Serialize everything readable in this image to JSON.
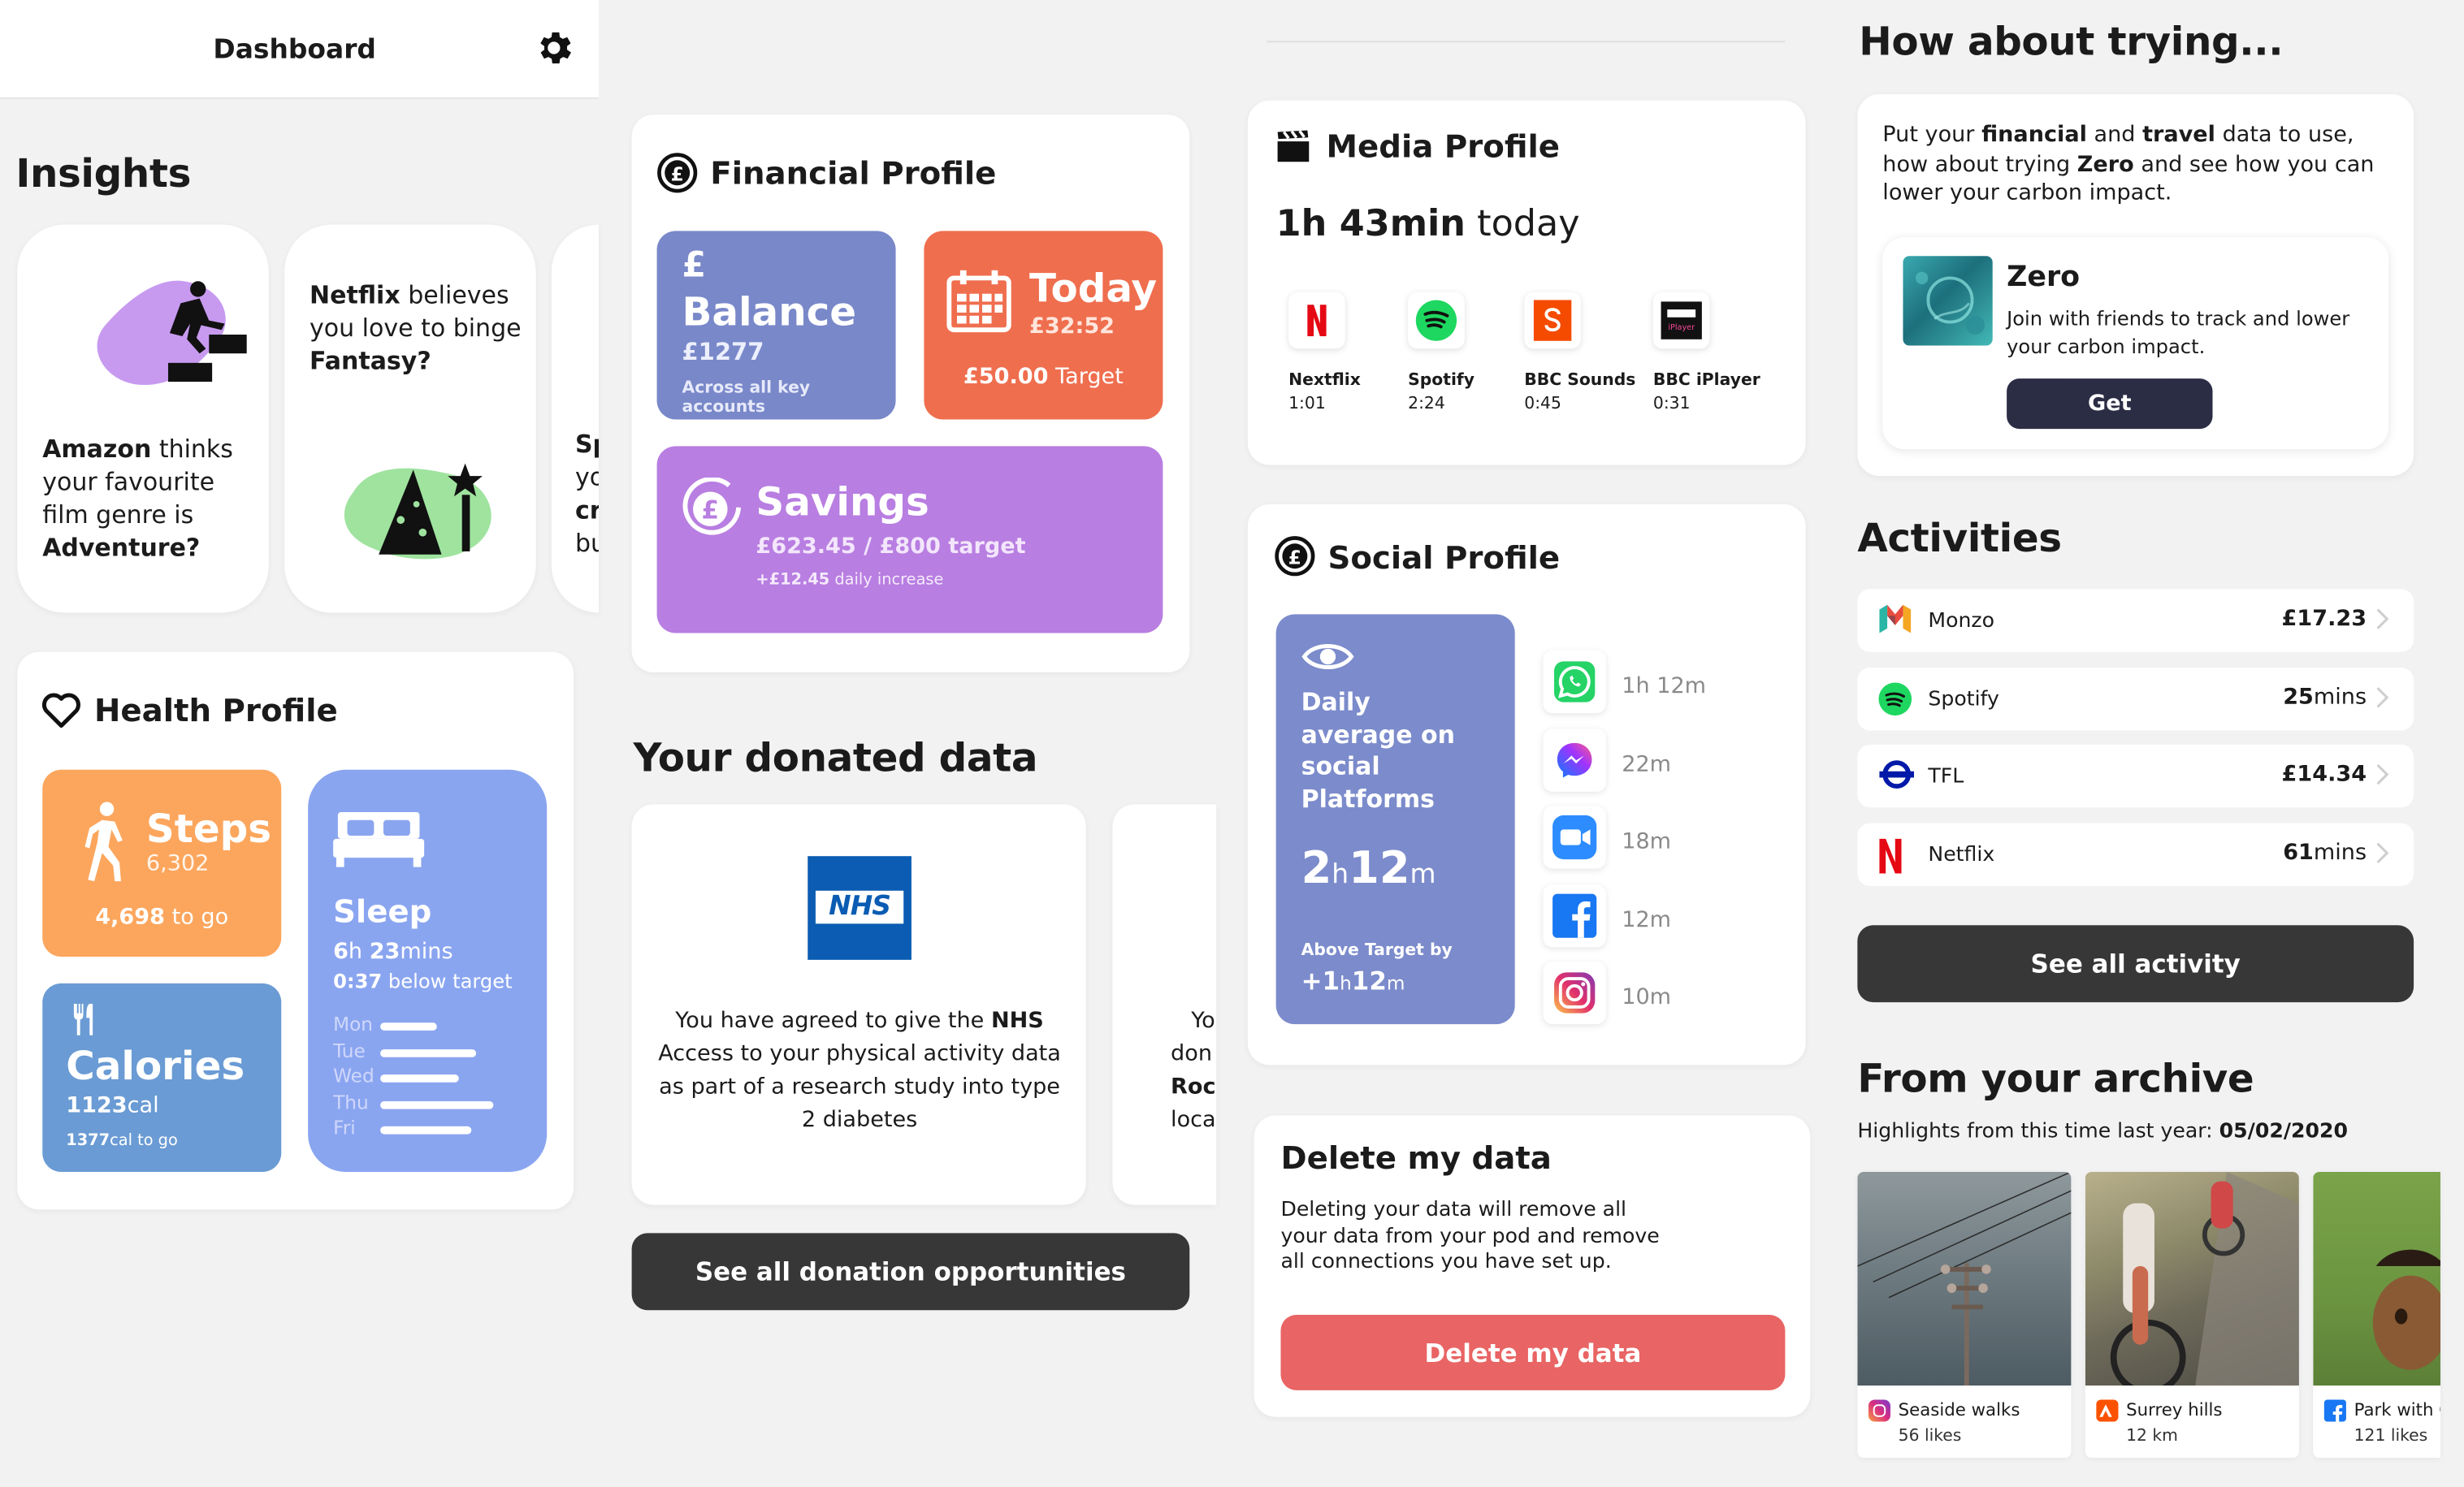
{
  "header": {
    "title": "Dashboard",
    "settings_icon": "gear-icon"
  },
  "insights": {
    "title": "Insights",
    "cards": [
      {
        "part1_bold": "Amazon",
        "part1": " thinks your favourite film genre is ",
        "part2_bold": "Adventure?",
        "illustration": "runner-on-steps-icon"
      },
      {
        "part1_bold": "Netflix",
        "part1": " believes you love to binge ",
        "part2_bold": "Fantasy?",
        "illustration": "wizard-hat-icon"
      },
      {
        "line1": "Sp",
        "line2": "yo",
        "line3_bold": "cr",
        "line4": "bu"
      }
    ]
  },
  "health": {
    "title": "Health Profile",
    "steps": {
      "label": "Steps",
      "count": "6,302",
      "to_go_bold": "4,698",
      "to_go": " to go"
    },
    "sleep": {
      "label": "Sleep",
      "h": "6",
      "h_unit": "h ",
      "m": "23",
      "m_unit": "mins",
      "below_bold": "0:37",
      "below": " below target",
      "days": [
        "Mon",
        "Tue",
        "Wed",
        "Thu",
        "Fri"
      ],
      "bars": [
        0.5,
        0.85,
        0.7,
        1.0,
        0.8
      ]
    },
    "calories": {
      "label": "Calories",
      "value": "1123",
      "unit": "cal",
      "togo_val": "1377",
      "togo_unit": "cal to go"
    }
  },
  "financial": {
    "title": "Financial Profile",
    "balance": {
      "symbol": "£",
      "label": "Balance",
      "amount": "£1277",
      "note": "Across all key accounts"
    },
    "today": {
      "label": "Today",
      "amount": "£32:52",
      "target_bold": "£50.00",
      "target": " Target"
    },
    "savings": {
      "label": "Savings",
      "progress": "£623.45 / £800 target",
      "increase_bold": "+£12.45",
      "increase": " daily increase"
    }
  },
  "donated": {
    "title": "Your donated data",
    "card1": {
      "logo": "NHS",
      "t1": "You have agreed to give the ",
      "t1_bold": "NHS",
      "t2": " Access to your physical activity data as part of a research study into type 2 diabetes"
    },
    "card2": {
      "l1": "Yo",
      "l2": "don",
      "l3_bold": "Roch",
      "l4": "loca"
    },
    "button": "See all donation opportunities"
  },
  "media": {
    "title": "Media Profile",
    "hm_bold": "1h 43min",
    "today": " today",
    "apps": [
      {
        "name": "Nextflix",
        "time": "1:01",
        "icon": "netflix-icon"
      },
      {
        "name": "Spotify",
        "time": "2:24",
        "icon": "spotify-icon"
      },
      {
        "name": "BBC Sounds",
        "time": "0:45",
        "icon": "bbc-sounds-icon"
      },
      {
        "name": "BBC iPlayer",
        "time": "0:31",
        "icon": "bbc-iplayer-icon"
      }
    ]
  },
  "social": {
    "title": "Social Profile",
    "avg_label": "Daily average on social Platforms",
    "avg_h": "2",
    "avg_h_unit": "h",
    "avg_m": "12",
    "avg_m_unit": "m",
    "above_label": "Above Target by",
    "above_prefix": "+1",
    "above_h_unit": "h",
    "above_m": "12",
    "above_m_unit": "m",
    "apps": [
      {
        "icon": "whatsapp-icon",
        "time": "1h 12m",
        "color": "#25d366"
      },
      {
        "icon": "messenger-icon",
        "time": "22m",
        "color": "#8a4cf5"
      },
      {
        "icon": "zoom-icon",
        "time": "18m",
        "color": "#2d8cff"
      },
      {
        "icon": "facebook-icon",
        "time": "12m",
        "color": "#1877f2"
      },
      {
        "icon": "instagram-icon",
        "time": "10m",
        "color": "#e1306c"
      }
    ]
  },
  "delete": {
    "title": "Delete my data",
    "body": "Deleting your data will remove all your data from your pod and remove all connections you have set up.",
    "button": "Delete my data"
  },
  "trying": {
    "title": "How about trying...",
    "p1": "Put your ",
    "p1_b1": "financial",
    "p1_and": " and ",
    "p1_b2": "travel",
    "p1_rest": " data to use, how about trying ",
    "p1_b3": "Zero",
    "p1_end": " and see how you can lower your carbon impact.",
    "app_name": "Zero",
    "app_desc": "Join with friends to track and lower your carbon impact.",
    "button": "Get"
  },
  "activities": {
    "title": "Activities",
    "rows": [
      {
        "name": "Monzo",
        "value": "£17.23",
        "unit": "",
        "icon": "monzo-icon"
      },
      {
        "name": "Spotify",
        "value": "25",
        "unit": "mins",
        "icon": "spotify-icon"
      },
      {
        "name": "TFL",
        "value": "£14.34",
        "unit": "",
        "icon": "tfl-icon"
      },
      {
        "name": "Netflix",
        "value": "61",
        "unit": "mins",
        "icon": "netflix-icon"
      }
    ],
    "button": "See all activity"
  },
  "archive": {
    "title": "From your archive",
    "sub": "Highlights from this time last year: ",
    "date": "05/02/2020",
    "photos": [
      {
        "title": "Seaside walks",
        "meta": "56 likes",
        "icon": "instagram-icon"
      },
      {
        "title": "Surrey hills",
        "meta": "12 km",
        "icon": "strava-icon"
      },
      {
        "title": "Park with O",
        "meta": "121 likes",
        "icon": "facebook-icon"
      }
    ]
  },
  "colors": {
    "blue_card": "#7988c9",
    "orange_card": "#ef6e4e",
    "purple_card": "#b87ee1",
    "steps": "#fca65d",
    "sleep": "#8aa5f0",
    "calories": "#6a9bd4",
    "social_card": "#7b8bcb",
    "delete": "#e96464",
    "dark": "#373737"
  }
}
